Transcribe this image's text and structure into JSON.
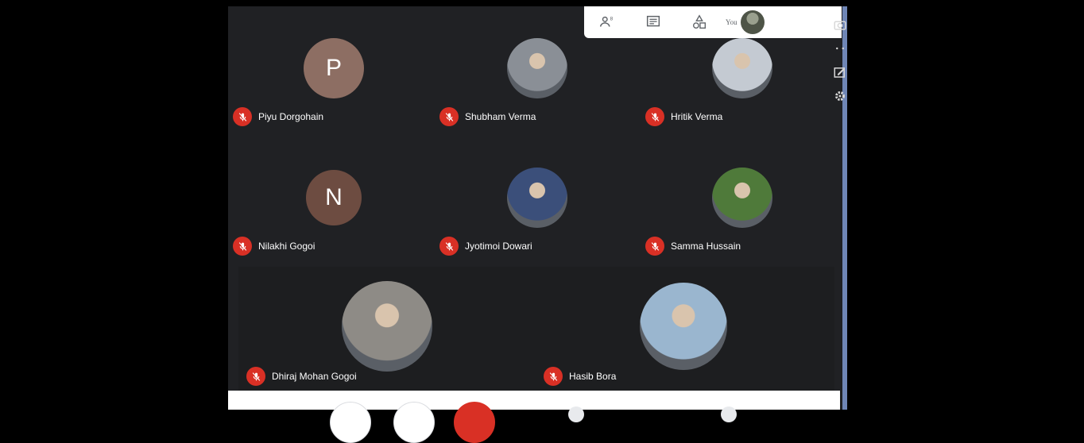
{
  "header": {
    "you_label": "You",
    "icons": [
      "participants-icon",
      "chat-icon",
      "activities-icon"
    ]
  },
  "participants": [
    {
      "name": "Piyu Dorgohain",
      "initial": "P",
      "avatar_color": "#8d6e63",
      "muted": true
    },
    {
      "name": "Shubham Verma",
      "initial": "",
      "avatar_color": "#8a8f96",
      "muted": true
    },
    {
      "name": "Hritik Verma",
      "initial": "",
      "avatar_color": "#c4cad2",
      "muted": true
    },
    {
      "name": "Nilakhi Gogoi",
      "initial": "N",
      "avatar_color": "#6d4c41",
      "muted": true
    },
    {
      "name": "Jyotimoi Dowari",
      "initial": "",
      "avatar_color": "#3b4f7a",
      "muted": true
    },
    {
      "name": "Samma Hussain",
      "initial": "",
      "avatar_color": "#4f7a3a",
      "muted": true
    },
    {
      "name": "Dhiraj Mohan Gogoi",
      "initial": "",
      "avatar_color": "#8e8b86",
      "muted": true
    },
    {
      "name": "Hasib Bora",
      "initial": "",
      "avatar_color": "#9ab6cf",
      "muted": true
    }
  ],
  "colors": {
    "muted_red": "#d93025",
    "meet_bg": "#202124",
    "side_accent": "#6f86b6"
  }
}
